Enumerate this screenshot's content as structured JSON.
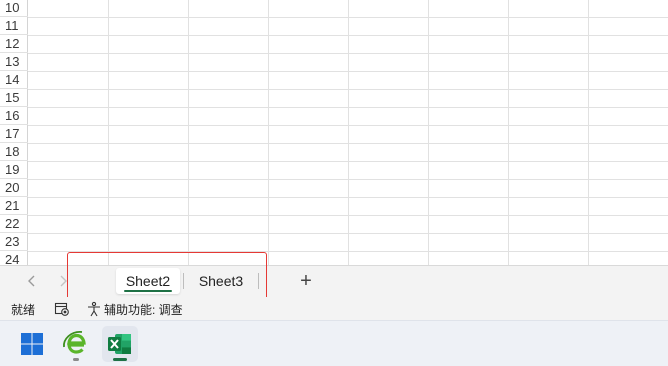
{
  "grid": {
    "row_numbers": [
      "10",
      "11",
      "12",
      "13",
      "14",
      "15",
      "16",
      "17",
      "18",
      "19",
      "20",
      "21",
      "22",
      "23",
      "24"
    ]
  },
  "sheet_tabs": {
    "prev_label": "<",
    "next_label": ">",
    "tabs": [
      {
        "label": "Sheet2",
        "active": true
      },
      {
        "label": "Sheet3",
        "active": false
      }
    ],
    "add_label": "+",
    "accent_color": "#1e7145",
    "highlight_color": "#e53935"
  },
  "status_bar": {
    "ready_text": "就绪",
    "macro_icon": "macro-record-icon",
    "accessibility_icon": "accessibility-icon",
    "accessibility_text": "辅助功能: 调查"
  },
  "taskbar": {
    "apps": [
      {
        "icon": "windows-start-icon"
      },
      {
        "icon": "browser-e-icon"
      },
      {
        "icon": "excel-icon",
        "active": true
      }
    ]
  }
}
